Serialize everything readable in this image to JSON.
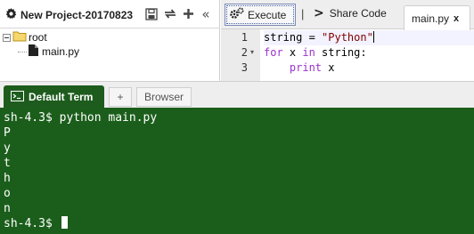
{
  "project": {
    "title": "New Project-20170823",
    "toolbar_icons": [
      "save-icon",
      "sync-icon",
      "add-icon",
      "collapse-icon"
    ],
    "collapse_glyph": "«",
    "tree": {
      "root_label": "root",
      "file_label": "main.py"
    }
  },
  "editor": {
    "execute_label": "Execute",
    "separator": "|",
    "share_label": "Share Code",
    "share_glyph": ">",
    "file_tab_label": "main.py",
    "file_tab_close": "x",
    "fold_glyph": "▾",
    "lines": [
      {
        "number": "1"
      },
      {
        "number": "2"
      },
      {
        "number": "3"
      }
    ],
    "code": {
      "l1_var": "string = ",
      "l1_str": "\"Python\"",
      "l2_kw1": "for",
      "l2_mid": " x ",
      "l2_kw2": "in",
      "l2_end": " string:",
      "l3_indent": "    ",
      "l3_kw": "print",
      "l3_end": " x"
    }
  },
  "terminal": {
    "tab_active_label": "Default Term",
    "tab_add_label": "+",
    "tab_browser_label": "Browser",
    "lines": [
      "sh-4.3$ python main.py",
      "P",
      "y",
      "t",
      "h",
      "o",
      "n"
    ],
    "prompt": "sh-4.3$ "
  },
  "colors": {
    "terminal_bg": "#1b5e1b",
    "tab_active_bg": "#1e5c1e",
    "keyword": "#9932cc",
    "string": "#800000"
  }
}
